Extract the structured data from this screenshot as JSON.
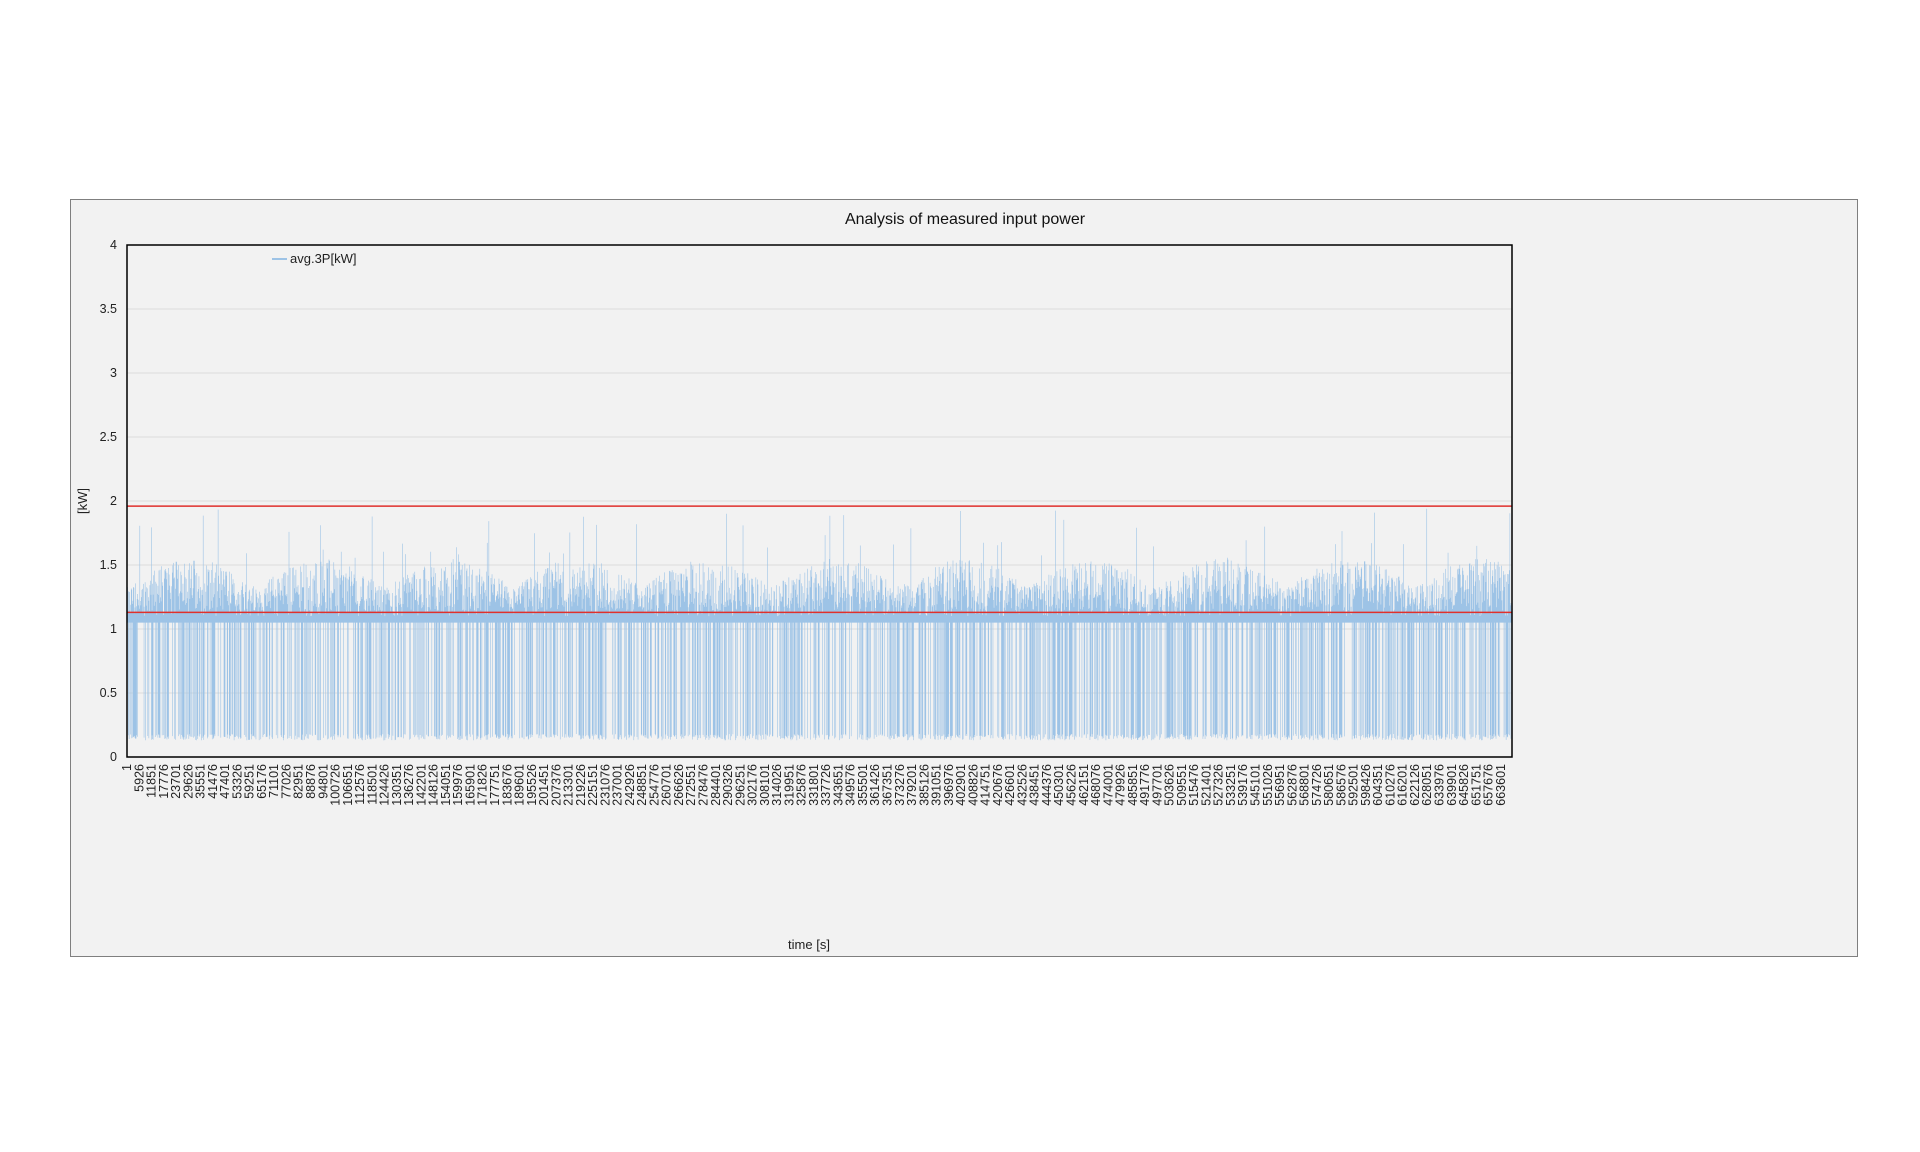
{
  "chart_data": {
    "type": "line",
    "title": "Analysis of measured input power",
    "xlabel": "time [s]",
    "ylabel": "[kW]",
    "ylim": [
      0,
      4
    ],
    "yticks": [
      0,
      0.5,
      1,
      1.5,
      2,
      2.5,
      3,
      3.5,
      4
    ],
    "ytick_labels": [
      "0",
      "0.5",
      "1",
      "1.5",
      "2",
      "2.5",
      "3",
      "3.5",
      "4"
    ],
    "xlim": [
      1,
      669000
    ],
    "x_tick_step": 5925,
    "x_tick_first": 1,
    "x_tick_count": 113,
    "grid": true,
    "legend_position": "top-left",
    "series": [
      {
        "name": "avg.3P[kW]",
        "color": "#9dc3e6",
        "baseline_kw": 1.05,
        "typical_band_kw": [
          1.1,
          1.55
        ],
        "peak_max_kw": 1.95,
        "dropout_low_kw": 0.13
      }
    ],
    "reference_lines": [
      {
        "value": 1.96,
        "color": "#e0302c"
      },
      {
        "value": 1.13,
        "color": "#e0302c"
      }
    ]
  }
}
